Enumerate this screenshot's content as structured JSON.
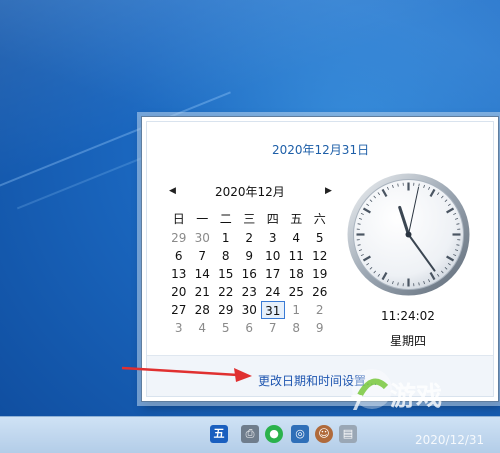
{
  "popup": {
    "long_date": "2020年12月31日",
    "calendar": {
      "prev_arrow": "◀",
      "next_arrow": "▶",
      "month_title": "2020年12月",
      "weekdays": [
        "日",
        "一",
        "二",
        "三",
        "四",
        "五",
        "六"
      ],
      "days": [
        [
          "29",
          "30",
          "1",
          "2",
          "3",
          "4",
          "5"
        ],
        [
          "6",
          "7",
          "8",
          "9",
          "10",
          "11",
          "12"
        ],
        [
          "13",
          "14",
          "15",
          "16",
          "17",
          "18",
          "19"
        ],
        [
          "20",
          "21",
          "22",
          "23",
          "24",
          "25",
          "26"
        ],
        [
          "27",
          "28",
          "29",
          "30",
          "31",
          "1",
          "2"
        ],
        [
          "3",
          "4",
          "5",
          "6",
          "7",
          "8",
          "9"
        ]
      ],
      "today": "31"
    },
    "clock": {
      "time": "11:24:02",
      "weekday": "星期四",
      "hour": 11,
      "minute": 24,
      "second": 2
    },
    "settings_link": "更改日期和时间设置..."
  },
  "taskbar": {
    "ime_label": "五",
    "icons": [
      "ime-icon",
      "printer-icon",
      "wechat-icon",
      "network-icon",
      "user-icon",
      "tray-more-icon"
    ]
  },
  "watermark": {
    "text": "2020/12/31"
  },
  "colors": {
    "link": "#1f56b0",
    "accent": "#1e5fa8",
    "today_border": "#3a7bd5",
    "arrow": "#e03030"
  }
}
